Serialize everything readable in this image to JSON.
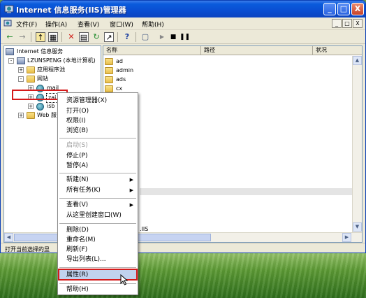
{
  "window": {
    "title": "Internet 信息服务(IIS)管理器",
    "buttons": {
      "minimize": "_",
      "maximize": "□",
      "close": "X"
    }
  },
  "menubar": {
    "items": [
      "文件(F)",
      "操作(A)",
      "查看(V)",
      "窗口(W)",
      "帮助(H)"
    ],
    "right_buttons": [
      "_",
      "□",
      "X"
    ]
  },
  "toolbar": {
    "tools": [
      "back-icon",
      "forward-icon",
      "up-icon",
      "show-tree-icon",
      "delete-icon",
      "properties-icon",
      "refresh-icon",
      "export-icon",
      "help-icon",
      "computer-icon",
      "play-icon",
      "stop-icon",
      "pause-icon"
    ]
  },
  "tree": {
    "root": "Internet 信息服务",
    "computer": "LZUNSPENG (本地计算机)",
    "app_pools": "应用程序池",
    "websites": "网站",
    "site_mail": "mail",
    "site_selected": "zai",
    "site_isb": "isb",
    "web_ext": "Web 服"
  },
  "list": {
    "columns": [
      "名称",
      "路径",
      "状况"
    ],
    "rows": [
      "ad",
      "admin",
      "ads",
      "cx"
    ],
    "trailing": ".IIS"
  },
  "statusbar": {
    "text": "打开当前选择的显"
  },
  "context_menu": {
    "items": [
      {
        "label": "资源管理器(X)",
        "disabled": false
      },
      {
        "label": "打开(O)",
        "disabled": false
      },
      {
        "label": "权限(I)",
        "disabled": false
      },
      {
        "label": "浏览(B)",
        "disabled": false
      },
      {
        "label": "启动(S)",
        "disabled": true
      },
      {
        "label": "停止(P)",
        "disabled": false
      },
      {
        "label": "暂停(A)",
        "disabled": false
      },
      {
        "label": "新建(N)",
        "disabled": false,
        "submenu": true
      },
      {
        "label": "所有任务(K)",
        "disabled": false,
        "submenu": true
      },
      {
        "label": "查看(V)",
        "disabled": false,
        "submenu": true
      },
      {
        "label": "从这里创建窗口(W)",
        "disabled": false
      },
      {
        "label": "删除(D)",
        "disabled": false
      },
      {
        "label": "重命名(M)",
        "disabled": false
      },
      {
        "label": "刷新(F)",
        "disabled": false
      },
      {
        "label": "导出列表(L)...",
        "disabled": false
      },
      {
        "label": "属性(R)",
        "disabled": false,
        "highlighted": true
      },
      {
        "label": "帮助(H)",
        "disabled": false
      }
    ]
  },
  "colors": {
    "accent": "#0a4ed2",
    "highlight_box": "#d51a1a",
    "menu_hover": "#c1d2ee"
  }
}
